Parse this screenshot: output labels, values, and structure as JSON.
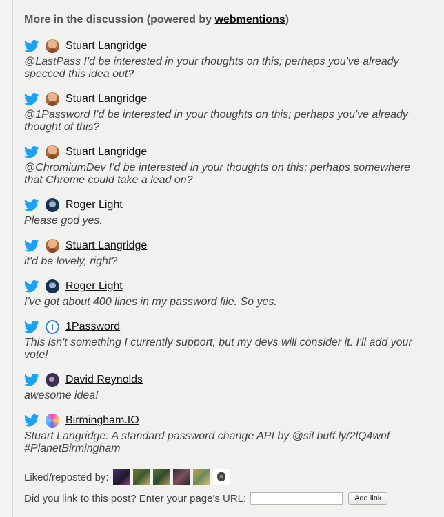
{
  "heading": {
    "prefix": "More in the discussion (powered by ",
    "link": "webmentions",
    "suffix": ")"
  },
  "mentions": [
    {
      "avatar": "stuart-avatar",
      "name": "Stuart Langridge",
      "text": "@LastPass I'd be interested in your thoughts on this; perhaps you've already specced this idea out?"
    },
    {
      "avatar": "stuart-avatar",
      "name": "Stuart Langridge",
      "text": "@1Password I'd be interested in your thoughts on this; perhaps you've already thought of this?"
    },
    {
      "avatar": "stuart-avatar",
      "name": "Stuart Langridge",
      "text": "@ChromiumDev I'd be interested in your thoughts on this; perhaps somewhere that Chrome could take a lead on?"
    },
    {
      "avatar": "roger-avatar",
      "name": "Roger Light",
      "text": "Please god yes."
    },
    {
      "avatar": "stuart-avatar",
      "name": "Stuart Langridge",
      "text": "it'd be lovely, right?"
    },
    {
      "avatar": "roger-avatar",
      "name": "Roger Light",
      "text": "I've got about 400 lines in my password file. So yes."
    },
    {
      "avatar": "1password-avatar",
      "name": "1Password",
      "text": "This isn't something I currently support, but my devs will consider it. I'll add your vote!"
    },
    {
      "avatar": "david-avatar",
      "name": "David Reynolds",
      "text": "awesome idea!"
    },
    {
      "avatar": "birmingham-avatar",
      "name": "Birmingham.IO",
      "text": "Stuart Langridge: A standard password change API by @sil buff.ly/2lQ4wnf #PlanetBirmingham"
    }
  ],
  "liked": {
    "label": "Liked/reposted by:",
    "count": 6
  },
  "link_form": {
    "prompt": "Did you link to this post? Enter your page's URL:",
    "input_value": "",
    "button_label": "Add link"
  },
  "colors": {
    "twitter": "#1da1f2",
    "background": "#f1f1f0"
  }
}
